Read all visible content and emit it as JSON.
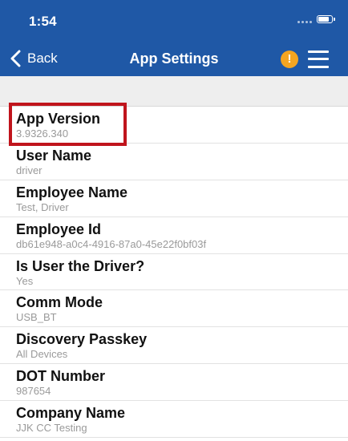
{
  "status_bar": {
    "time": "1:54"
  },
  "nav": {
    "back_label": "Back",
    "title": "App Settings",
    "alert_symbol": "!"
  },
  "colors": {
    "header_bg": "#1f58a6",
    "alert": "#f4a521",
    "highlight": "#c0141c"
  },
  "settings": [
    {
      "label": "App Version",
      "value": "3.9326.340"
    },
    {
      "label": "User Name",
      "value": "driver"
    },
    {
      "label": "Employee Name",
      "value": "Test, Driver"
    },
    {
      "label": "Employee Id",
      "value": "db61e948-a0c4-4916-87a0-45e22f0bf03f"
    },
    {
      "label": "Is User the Driver?",
      "value": "Yes"
    },
    {
      "label": "Comm Mode",
      "value": "USB_BT"
    },
    {
      "label": "Discovery Passkey",
      "value": "All Devices"
    },
    {
      "label": "DOT Number",
      "value": "987654"
    },
    {
      "label": "Company Name",
      "value": "JJK CC Testing"
    }
  ]
}
